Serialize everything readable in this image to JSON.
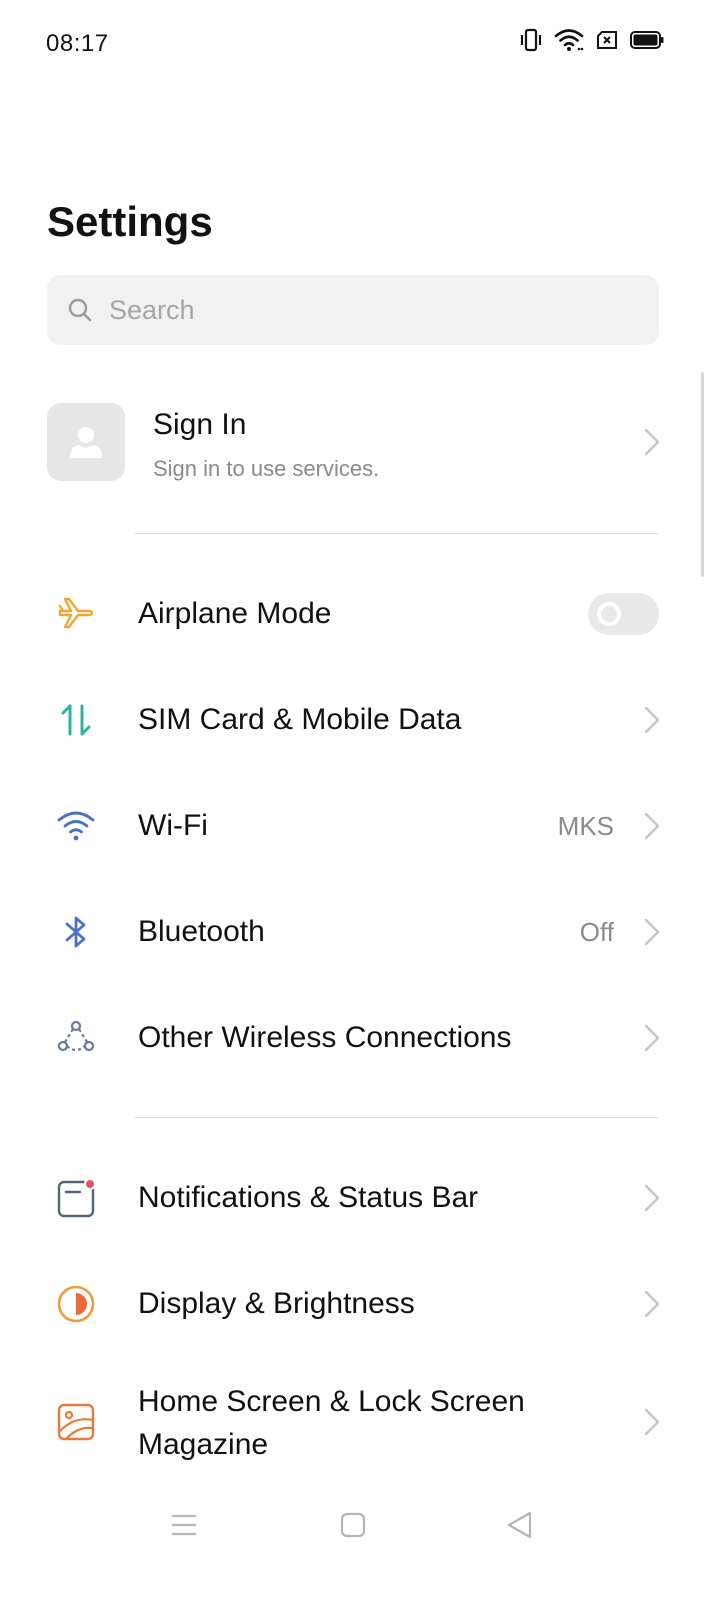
{
  "status_bar": {
    "time": "08:17",
    "icons": [
      "vibrate-icon",
      "wifi-icon",
      "sim-off-icon",
      "battery-icon"
    ]
  },
  "page": {
    "title": "Settings"
  },
  "search": {
    "placeholder": "Search",
    "value": ""
  },
  "account": {
    "title": "Sign In",
    "subtitle": "Sign in to use services."
  },
  "settings_group_1": [
    {
      "label": "Airplane Mode",
      "icon": "airplane-icon",
      "toggle_on": false
    },
    {
      "label": "SIM Card & Mobile Data",
      "icon": "data-arrows-icon"
    },
    {
      "label": "Wi-Fi",
      "icon": "wifi-icon",
      "value": "MKS"
    },
    {
      "label": "Bluetooth",
      "icon": "bluetooth-icon",
      "value": "Off"
    },
    {
      "label": "Other Wireless Connections",
      "icon": "wireless-connections-icon"
    }
  ],
  "settings_group_2": [
    {
      "label": "Notifications & Status Bar",
      "icon": "notification-icon"
    },
    {
      "label": "Display & Brightness",
      "icon": "brightness-icon"
    },
    {
      "label_line1": "Home Screen & Lock Screen",
      "label_line2": "Magazine",
      "icon": "home-screen-icon"
    }
  ],
  "colors": {
    "airplane": "#f0a531",
    "sim": "#2bb3a0",
    "wifi": "#4a6fc6",
    "bluetooth": "#4a6fc6",
    "wireless": "#6b7b95",
    "notifications": "#56647a",
    "notification_dot": "#e8505b",
    "display": "#f19a3e",
    "home_screen": "#e8793a"
  },
  "nav_bar": {
    "buttons": [
      "menu-icon",
      "home-icon",
      "back-icon"
    ]
  }
}
